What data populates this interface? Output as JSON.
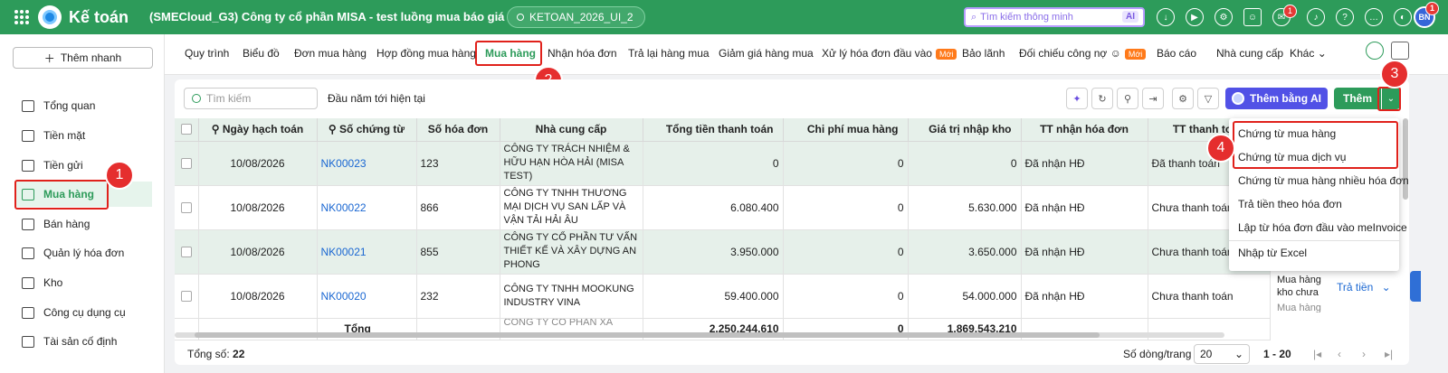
{
  "header": {
    "app_name": "Kế toán",
    "company": "(SMECloud_G3) Công ty cổ phần MISA - test luồng mua báo giá mới",
    "database": "KETOAN_2026_UI_2",
    "search_placeholder": "Tìm kiếm thông minh",
    "search_ai": "AI",
    "chat_badge": "1",
    "avatar_initials": "BN",
    "avatar_badge": "1"
  },
  "sidebar": {
    "quick_add": "Thêm nhanh",
    "items": [
      {
        "label": "Tổng quan"
      },
      {
        "label": "Tiền mặt"
      },
      {
        "label": "Tiền gửi"
      },
      {
        "label": "Mua hàng"
      },
      {
        "label": "Bán hàng"
      },
      {
        "label": "Quản lý hóa đơn"
      },
      {
        "label": "Kho"
      },
      {
        "label": "Công cụ dụng cụ"
      },
      {
        "label": "Tài sản cố định"
      }
    ]
  },
  "tabs": [
    {
      "label": "Quy trình"
    },
    {
      "label": "Biểu đồ"
    },
    {
      "label": "Đơn mua hàng"
    },
    {
      "label": "Hợp đồng mua hàng"
    },
    {
      "label": "Mua hàng"
    },
    {
      "label": "Nhận hóa đơn"
    },
    {
      "label": "Trả lại hàng mua"
    },
    {
      "label": "Giảm giá hàng mua"
    },
    {
      "label": "Xử lý hóa đơn đầu vào"
    },
    {
      "label": "Bảo lãnh"
    },
    {
      "label": "Đối chiếu công nợ"
    },
    {
      "label": "Báo cáo"
    },
    {
      "label": "Nhà cung cấp"
    },
    {
      "label": "Khác"
    }
  ],
  "new_tag": "Mới",
  "toolbar": {
    "search_placeholder": "Tìm kiếm",
    "period": "Đầu năm tới hiện tại",
    "ai_button": "Thêm bằng AI",
    "add_button": "Thêm"
  },
  "table": {
    "columns": [
      "Ngày hạch toán",
      "Số chứng từ",
      "Số hóa đơn",
      "Nhà cung cấp",
      "Tổng tiền thanh toán",
      "Chi phí mua hàng",
      "Giá trị nhập kho",
      "TT nhận hóa đơn",
      "TT thanh toán"
    ],
    "rows": [
      {
        "date": "10/08/2026",
        "voucher": "NK00023",
        "invoice": "123",
        "vendor": "CÔNG TY TRÁCH NHIỆM & HỮU HẠN HÒA HẢI (MISA TEST)",
        "total": "0",
        "cost": "0",
        "stock": "0",
        "invoice_status": "Đã nhận HĐ",
        "pay_status": "Đã thanh toán"
      },
      {
        "date": "10/08/2026",
        "voucher": "NK00022",
        "invoice": "866",
        "vendor": "CÔNG TY TNHH THƯƠNG MẠI DỊCH VỤ SAN LẤP VÀ VẬN TẢI HẢI ÂU",
        "total": "6.080.400",
        "cost": "0",
        "stock": "5.630.000",
        "invoice_status": "Đã nhận HĐ",
        "pay_status": "Chưa thanh toán"
      },
      {
        "date": "10/08/2026",
        "voucher": "NK00021",
        "invoice": "855",
        "vendor": "CÔNG TY CỔ PHẦN TƯ VẤN THIẾT KẾ VÀ XÂY DỰNG AN PHONG",
        "total": "3.950.000",
        "cost": "0",
        "stock": "3.650.000",
        "invoice_status": "Đã nhận HĐ",
        "pay_status": "Chưa thanh toán"
      },
      {
        "date": "10/08/2026",
        "voucher": "NK00020",
        "invoice": "232",
        "vendor": "CÔNG TY TNHH MOOKUNG INDUSTRY VINA",
        "total": "59.400.000",
        "cost": "0",
        "stock": "54.000.000",
        "invoice_status": "Đã nhận HĐ",
        "pay_status": "Chưa thanh toán",
        "extra": "Mua hàng kho chưa",
        "action": "Trả tiền"
      }
    ],
    "partial_row_vendor": "CÔNG TY CỔ PHẦN XÂ",
    "partial_row_extra": "Mua hàng",
    "total_label": "Tổng",
    "total_amount": "2.250.244.610",
    "total_cost": "0",
    "total_stock": "1.869.543.210"
  },
  "dropdown": {
    "items": [
      "Chứng từ mua hàng",
      "Chứng từ mua dịch vụ",
      "Chứng từ mua hàng nhiều hóa đơn",
      "Trả tiền theo hóa đơn",
      "Lập từ hóa đơn đầu vào meInvoice",
      "Nhập từ Excel"
    ]
  },
  "footer": {
    "count_label": "Tổng số:",
    "count": "22",
    "rows_per_page_label": "Số dòng/trang",
    "rows_per_page": "20",
    "range": "1 - 20"
  },
  "markers": [
    "1",
    "2",
    "3",
    "4"
  ],
  "colors": {
    "primary": "#2d9b5a",
    "annotation": "#e52e2e",
    "ai_button": "#5151e6",
    "link": "#1a67d2"
  }
}
